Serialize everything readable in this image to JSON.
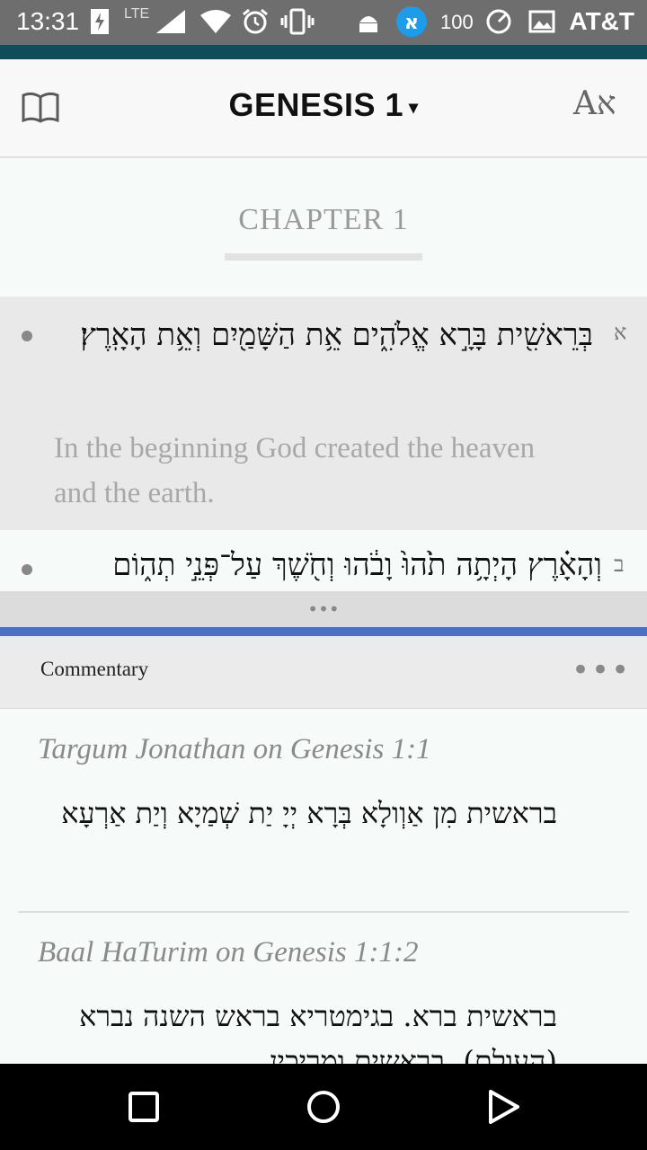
{
  "status_bar": {
    "time": "13:31",
    "network": "LTE",
    "battery": "100",
    "carrier": "AT&T",
    "icons": [
      "flash-icon",
      "signal-icon",
      "wifi-icon",
      "alarm-icon",
      "vibrate-icon",
      "android-icon",
      "sefaria-icon",
      "sync-icon",
      "image-icon"
    ]
  },
  "header": {
    "title": "GENESIS 1",
    "caret": "▾",
    "lang_toggle": "Aא"
  },
  "chapter": {
    "title": "CHAPTER 1"
  },
  "verses": [
    {
      "num": "א",
      "hebrew": "בְּרֵאשִׁ֖ית בָּרָ֣א אֱלֹהִ֑ים אֵ֥ת הַשָּׁמַ֖יִם וְאֵ֥ת הָאָֽרֶץ׃",
      "english": "In the beginning God created the heaven and the earth."
    },
    {
      "num": "ב",
      "hebrew": "וְהָאָ֗רֶץ הָיְתָ֥ה תֹ֙הוּ֙ וָבֹ֔הוּ וְחֹ֖שֶׁךְ עַל־פְּנֵ֣י תְה֑וֹם"
    }
  ],
  "divider": {
    "dots": "•••"
  },
  "commentary": {
    "label": "Commentary",
    "more": "•••",
    "entries": [
      {
        "source": "Targum Jonathan on Genesis 1:1",
        "text": "בראשית מִן אַוְולָא בְּרָא יְיָ יַת שְׁמַיָא וְיַת אַרְעָא"
      },
      {
        "source": "Baal HaTurim on Genesis 1:1:2",
        "text": "בראשית ברא. בגימטריא בראש השנה נברא (העולם). בראשית ומריכין"
      }
    ]
  },
  "colors": {
    "teal": "#0f4d5a",
    "accent_blue": "#4b71c2",
    "highlight": "#e9e9e9"
  }
}
